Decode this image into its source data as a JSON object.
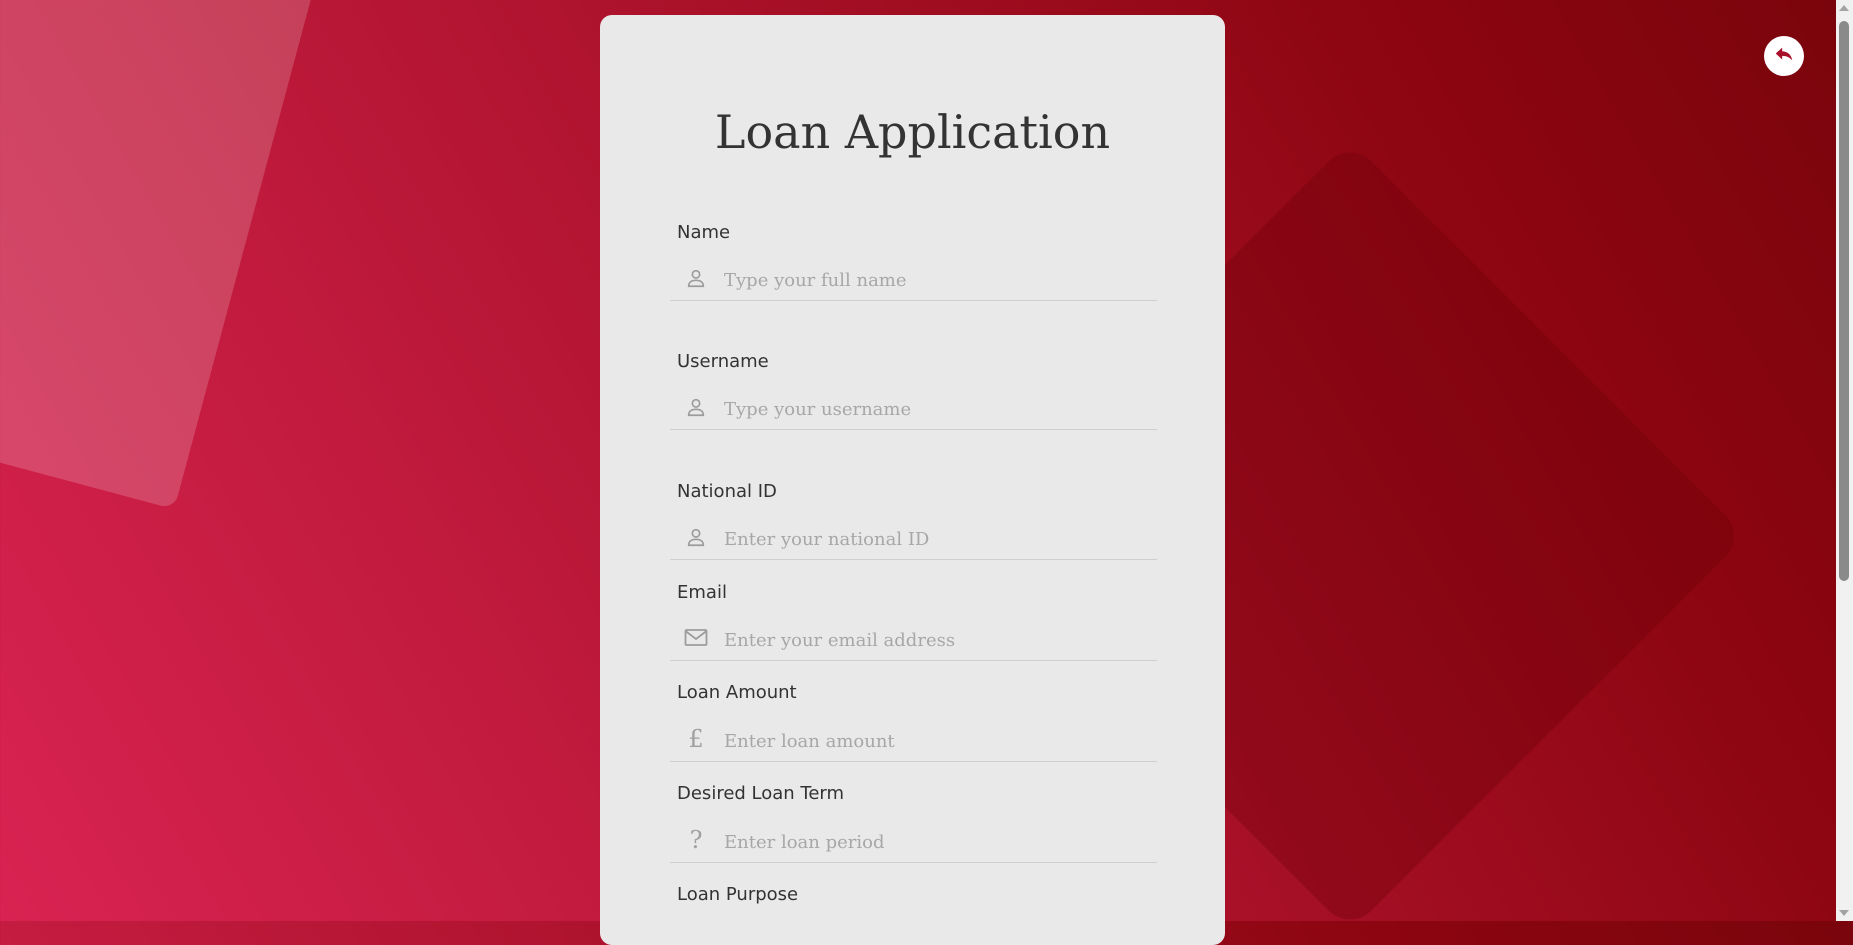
{
  "form": {
    "title": "Loan Application",
    "fields": [
      {
        "label": "Name",
        "placeholder": "Type your full name",
        "icon": "user-icon"
      },
      {
        "label": "Username",
        "placeholder": "Type your username",
        "icon": "user-icon"
      },
      {
        "label": "National ID",
        "placeholder": "Enter your national ID",
        "icon": "user-icon"
      },
      {
        "label": "Email",
        "placeholder": "Enter your email address",
        "icon": "mail-icon"
      },
      {
        "label": "Loan Amount",
        "placeholder": "Enter loan amount",
        "icon": "pound-icon",
        "icon_glyph": "£"
      },
      {
        "label": "Desired Loan Term",
        "placeholder": "Enter loan period",
        "icon": "question-icon",
        "icon_glyph": "?"
      },
      {
        "label": "Loan Purpose"
      }
    ]
  },
  "back_button": {
    "icon": "reply-arrow-icon"
  },
  "colors": {
    "background_start": "#d92352",
    "background_end": "#7a050c",
    "card": "#e9e9e9",
    "accent": "#a8102a"
  }
}
